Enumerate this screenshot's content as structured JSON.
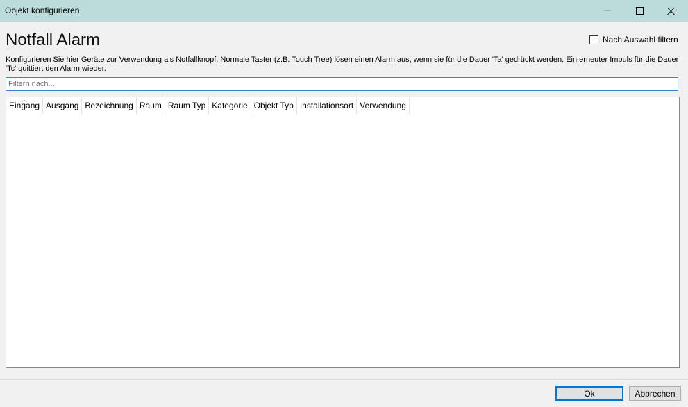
{
  "window": {
    "title": "Objekt konfigurieren"
  },
  "header": {
    "title": "Notfall Alarm",
    "filter_checkbox_label": "Nach Auswahl filtern",
    "filter_checked": false
  },
  "description": "Konfigurieren Sie hier Geräte zur Verwendung als Notfallknopf. Normale Taster (z.B. Touch Tree) lösen einen Alarm aus, wenn sie für die Dauer 'Ta' gedrückt werden. Ein erneuter Impuls für die Dauer 'Tc' quittiert den Alarm wieder.",
  "search": {
    "placeholder": "Filtern nach...",
    "value": ""
  },
  "table": {
    "columns": [
      "Eingang",
      "Ausgang",
      "Bezeichnung",
      "Raum",
      "Raum Typ",
      "Kategorie",
      "Objekt Typ",
      "Installationsort",
      "Verwendung"
    ],
    "rows": []
  },
  "footer": {
    "ok_label": "Ok",
    "cancel_label": "Abbrechen"
  },
  "colors": {
    "titlebar": "#bcdcdb",
    "focus_accent": "#0078d7"
  }
}
